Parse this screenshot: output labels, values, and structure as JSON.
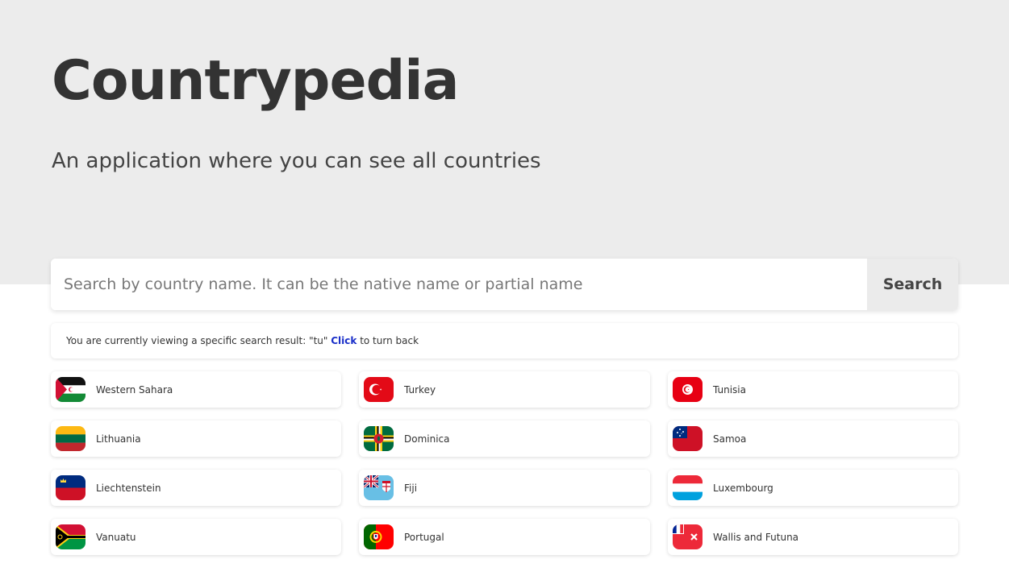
{
  "header": {
    "title": "Countrypedia",
    "subtitle": "An application where you can see all countries"
  },
  "search": {
    "placeholder": "Search by country name. It can be the native name or partial name",
    "value": "",
    "button_label": "Search"
  },
  "result_info": {
    "prefix": "You are currently viewing a specific search result: \"tu\" ",
    "link_label": "Click",
    "suffix": " to turn back"
  },
  "countries": [
    {
      "name": "Western Sahara",
      "flag_icon": "western-sahara-flag"
    },
    {
      "name": "Turkey",
      "flag_icon": "turkey-flag"
    },
    {
      "name": "Tunisia",
      "flag_icon": "tunisia-flag"
    },
    {
      "name": "Lithuania",
      "flag_icon": "lithuania-flag"
    },
    {
      "name": "Dominica",
      "flag_icon": "dominica-flag"
    },
    {
      "name": "Samoa",
      "flag_icon": "samoa-flag"
    },
    {
      "name": "Liechtenstein",
      "flag_icon": "liechtenstein-flag"
    },
    {
      "name": "Fiji",
      "flag_icon": "fiji-flag"
    },
    {
      "name": "Luxembourg",
      "flag_icon": "luxembourg-flag"
    },
    {
      "name": "Vanuatu",
      "flag_icon": "vanuatu-flag"
    },
    {
      "name": "Portugal",
      "flag_icon": "portugal-flag"
    },
    {
      "name": "Wallis and Futuna",
      "flag_icon": "wallis-and-futuna-flag"
    }
  ],
  "colors": {
    "hero_background": "#ececec",
    "link": "#1a2fc9",
    "search_button_background": "#ebebeb"
  }
}
